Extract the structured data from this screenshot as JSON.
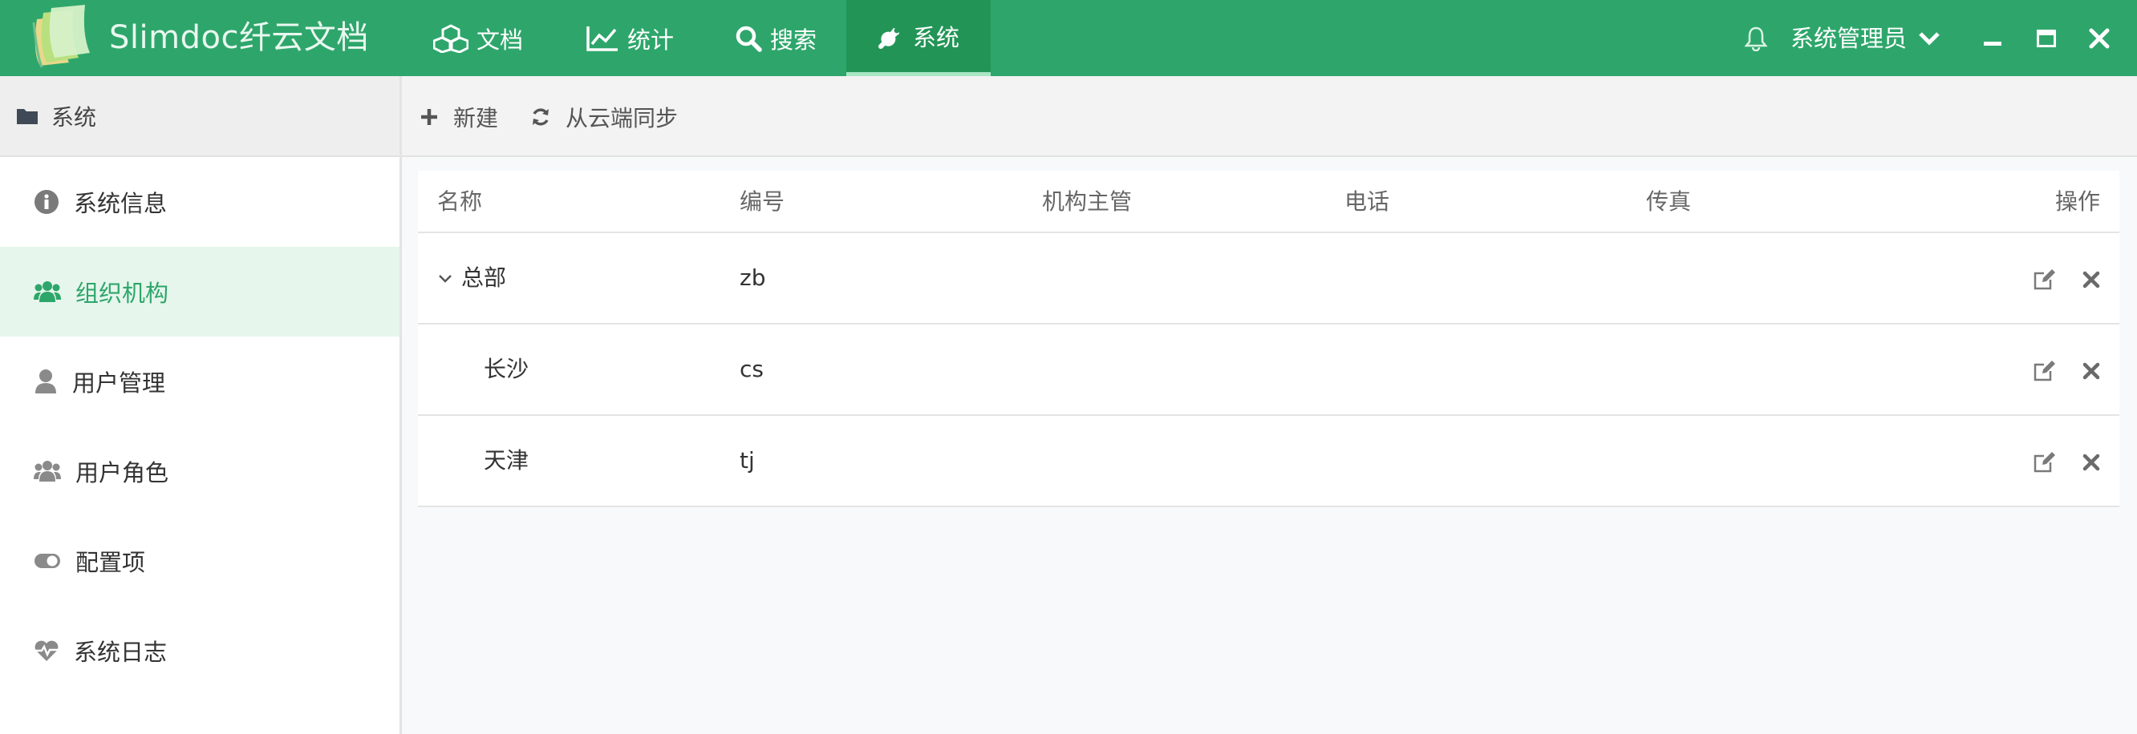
{
  "app": {
    "title": "Slimdoc纤云文档",
    "brand_color": "#2ea66b"
  },
  "nav": {
    "tabs": [
      {
        "label": "文档",
        "icon": "cubes-icon"
      },
      {
        "label": "统计",
        "icon": "line-chart-icon"
      },
      {
        "label": "搜索",
        "icon": "search-icon"
      },
      {
        "label": "系统",
        "icon": "wrench-icon",
        "active": true
      }
    ]
  },
  "user": {
    "name": "系统管理员",
    "icons": [
      "bell-icon",
      "chevron-down-icon"
    ]
  },
  "window_controls": [
    "minimize-icon",
    "maximize-icon",
    "close-icon"
  ],
  "sidebar": {
    "header": "系统",
    "items": [
      {
        "label": "系统信息",
        "icon": "info-circle-icon"
      },
      {
        "label": "组织机构",
        "icon": "users-icon",
        "active": true
      },
      {
        "label": "用户管理",
        "icon": "user-icon"
      },
      {
        "label": "用户角色",
        "icon": "user-group-icon"
      },
      {
        "label": "配置项",
        "icon": "toggle-icon"
      },
      {
        "label": "系统日志",
        "icon": "heartbeat-icon"
      }
    ]
  },
  "toolbar": {
    "new_label": "新建",
    "sync_label": "从云端同步"
  },
  "table": {
    "columns": [
      "名称",
      "编号",
      "机构主管",
      "电话",
      "传真",
      "操作"
    ],
    "rows": [
      {
        "name": "总部",
        "code": "zb",
        "manager": "",
        "phone": "",
        "fax": "",
        "expanded": true,
        "level": 0
      },
      {
        "name": "长沙",
        "code": "cs",
        "manager": "",
        "phone": "",
        "fax": "",
        "level": 1
      },
      {
        "name": "天津",
        "code": "tj",
        "manager": "",
        "phone": "",
        "fax": "",
        "level": 1
      }
    ],
    "row_actions": [
      "edit-icon",
      "delete-icon"
    ]
  }
}
